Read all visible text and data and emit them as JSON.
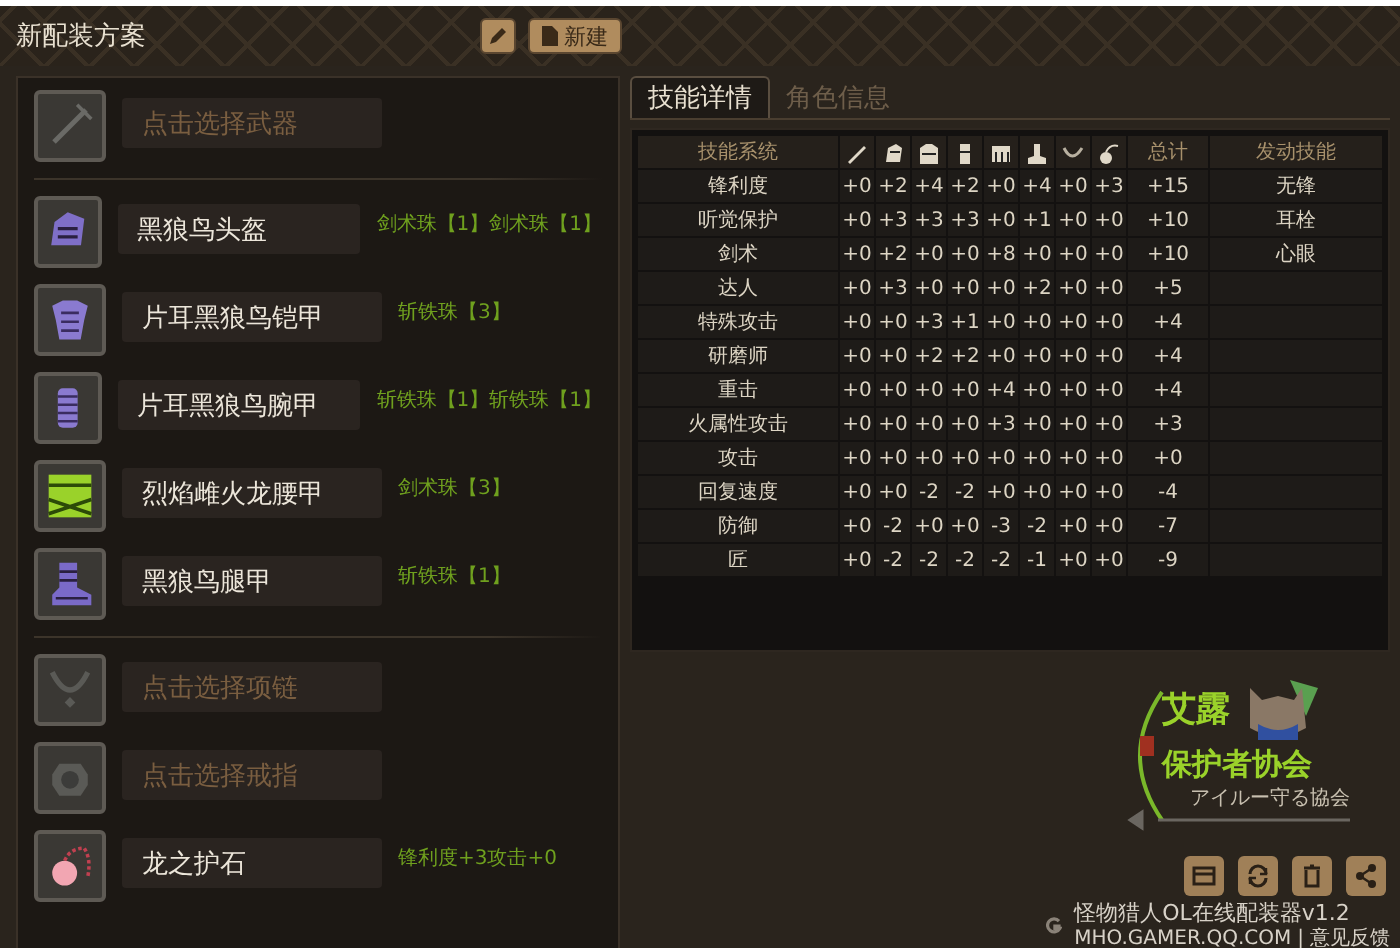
{
  "header": {
    "title": "新配装方案",
    "buttons": [
      {
        "kind": "edit"
      },
      {
        "kind": "new",
        "label": "新建"
      }
    ]
  },
  "equipment_groups": [
    {
      "slots": [
        {
          "kind": "empty",
          "name": "点击选择武器"
        }
      ]
    },
    {
      "slots": [
        {
          "kind": "item",
          "name": "黑狼鸟头盔",
          "jewels": "剑术珠【1】剑术珠【1】"
        },
        {
          "kind": "item",
          "name": "片耳黑狼鸟铠甲",
          "jewels": "斩铁珠【3】"
        },
        {
          "kind": "item",
          "name": "片耳黑狼鸟腕甲",
          "jewels": "斩铁珠【1】斩铁珠【1】"
        },
        {
          "kind": "item",
          "name": "烈焰雌火龙腰甲",
          "jewels": "剑术珠【3】"
        },
        {
          "kind": "item",
          "name": "黑狼鸟腿甲",
          "jewels": "斩铁珠【1】"
        }
      ]
    },
    {
      "slots": [
        {
          "kind": "empty",
          "name": "点击选择项链"
        },
        {
          "kind": "empty",
          "name": "点击选择戒指"
        },
        {
          "kind": "item",
          "name": "龙之护石",
          "jewels": "锋利度+3攻击+0"
        }
      ]
    }
  ],
  "tabs": [
    {
      "label": "技能详情",
      "selected": true
    },
    {
      "label": "角色信息",
      "selected": false
    }
  ],
  "table": {
    "columns": [
      {
        "kind": "text",
        "label": "技能系统"
      },
      {
        "kind": "icon"
      },
      {
        "kind": "icon"
      },
      {
        "kind": "icon"
      },
      {
        "kind": "icon"
      },
      {
        "kind": "icon"
      },
      {
        "kind": "icon"
      },
      {
        "kind": "icon"
      },
      {
        "kind": "icon"
      },
      {
        "kind": "text",
        "label": "总计"
      },
      {
        "kind": "text",
        "label": "发动技能"
      }
    ],
    "rows": [
      {
        "skill": "锋利度",
        "values": [
          "+0",
          "+2",
          "+4",
          "+2",
          "+0",
          "+4",
          "+0",
          "+3"
        ],
        "total": "+15",
        "activated": "无锋"
      },
      {
        "skill": "听觉保护",
        "values": [
          "+0",
          "+3",
          "+3",
          "+3",
          "+0",
          "+1",
          "+0",
          "+0"
        ],
        "total": "+10",
        "activated": "耳栓"
      },
      {
        "skill": "剑术",
        "values": [
          "+0",
          "+2",
          "+0",
          "+0",
          "+8",
          "+0",
          "+0",
          "+0"
        ],
        "total": "+10",
        "activated": "心眼"
      },
      {
        "skill": "达人",
        "values": [
          "+0",
          "+3",
          "+0",
          "+0",
          "+0",
          "+2",
          "+0",
          "+0"
        ],
        "total": "+5"
      },
      {
        "skill": "特殊攻击",
        "values": [
          "+0",
          "+0",
          "+3",
          "+1",
          "+0",
          "+0",
          "+0",
          "+0"
        ],
        "total": "+4"
      },
      {
        "skill": "研磨师",
        "values": [
          "+0",
          "+0",
          "+2",
          "+2",
          "+0",
          "+0",
          "+0",
          "+0"
        ],
        "total": "+4"
      },
      {
        "skill": "重击",
        "values": [
          "+0",
          "+0",
          "+0",
          "+0",
          "+4",
          "+0",
          "+0",
          "+0"
        ],
        "total": "+4"
      },
      {
        "skill": "火属性攻击",
        "values": [
          "+0",
          "+0",
          "+0",
          "+0",
          "+3",
          "+0",
          "+0",
          "+0"
        ],
        "total": "+3"
      },
      {
        "skill": "攻击",
        "values": [
          "+0",
          "+0",
          "+0",
          "+0",
          "+0",
          "+0",
          "+0",
          "+0"
        ],
        "total": "+0"
      },
      {
        "skill": "回复速度",
        "values": [
          "+0",
          "+0",
          "-2",
          "-2",
          "+0",
          "+0",
          "+0",
          "+0"
        ],
        "total": "-4"
      },
      {
        "skill": "防御",
        "values": [
          "+0",
          "-2",
          "+0",
          "+0",
          "-3",
          "-2",
          "+0",
          "+0"
        ],
        "total": "-7"
      },
      {
        "skill": "匠",
        "values": [
          "+0",
          "-2",
          "-2",
          "-2",
          "-2",
          "-1",
          "+0",
          "+0"
        ],
        "total": "-9"
      }
    ]
  },
  "logo": {
    "title_top": "艾露",
    "title_bottom": "保护者协会",
    "subtitle": "アイルー守る協会"
  },
  "actions": [
    {
      "kind": "save"
    },
    {
      "kind": "refresh"
    },
    {
      "kind": "delete"
    },
    {
      "kind": "share"
    }
  ],
  "footer": {
    "app_name": "怪物猎人OL在线配装器v1.2",
    "site": "MHO.GAMER.QQ.COM",
    "separator": "|",
    "feedback_link": "意见反馈"
  }
}
